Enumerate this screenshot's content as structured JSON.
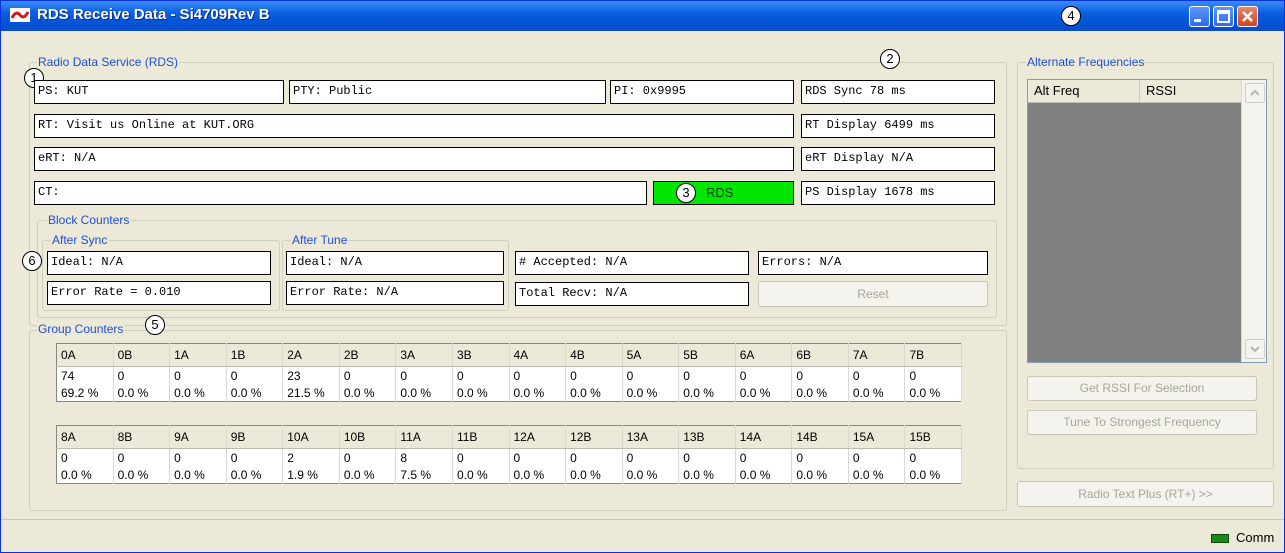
{
  "window": {
    "title": "RDS Receive Data - Si4709Rev B",
    "accent": "#0a5fe0"
  },
  "rds": {
    "group_label": "Radio Data Service (RDS)",
    "ps": "PS: KUT",
    "pty": "PTY: Public",
    "pi": "PI: 0x9995",
    "rt": "RT: Visit us Online at KUT.ORG",
    "ert": "eRT: N/A",
    "ct": "CT:",
    "indicator": "RDS",
    "indicator_color": "#00e600",
    "rds_sync": "RDS Sync 78 ms",
    "rt_display": "RT Display 6499 ms",
    "ert_display": "eRT Display N/A",
    "ps_display": "PS Display 1678 ms"
  },
  "block_counters": {
    "label": "Block Counters",
    "after_sync": {
      "label": "After Sync",
      "ideal": "Ideal: N/A",
      "error_rate": "Error Rate = 0.010"
    },
    "after_tune": {
      "label": "After Tune",
      "ideal": "Ideal: N/A",
      "error_rate": "Error Rate:  N/A"
    },
    "accepted": "# Accepted: N/A",
    "errors": "Errors: N/A",
    "total_recv": "Total Recv: N/A",
    "reset_label": "Reset"
  },
  "group_counters": {
    "label": "Group Counters",
    "table1": {
      "headers": [
        "0A",
        "0B",
        "1A",
        "1B",
        "2A",
        "2B",
        "3A",
        "3B",
        "4A",
        "4B",
        "5A",
        "5B",
        "6A",
        "6B",
        "7A",
        "7B"
      ],
      "counts": [
        "74",
        "0",
        "0",
        "0",
        "23",
        "0",
        "0",
        "0",
        "0",
        "0",
        "0",
        "0",
        "0",
        "0",
        "0",
        "0"
      ],
      "percents": [
        "69.2 %",
        "0.0 %",
        "0.0 %",
        "0.0 %",
        "21.5 %",
        "0.0 %",
        "0.0 %",
        "0.0 %",
        "0.0 %",
        "0.0 %",
        "0.0 %",
        "0.0 %",
        "0.0 %",
        "0.0 %",
        "0.0 %",
        "0.0 %"
      ]
    },
    "table2": {
      "headers": [
        "8A",
        "8B",
        "9A",
        "9B",
        "10A",
        "10B",
        "11A",
        "11B",
        "12A",
        "12B",
        "13A",
        "13B",
        "14A",
        "14B",
        "15A",
        "15B"
      ],
      "counts": [
        "0",
        "0",
        "0",
        "0",
        "2",
        "0",
        "8",
        "0",
        "0",
        "0",
        "0",
        "0",
        "0",
        "0",
        "0",
        "0"
      ],
      "percents": [
        "0.0 %",
        "0.0 %",
        "0.0 %",
        "0.0 %",
        "1.9 %",
        "0.0 %",
        "7.5 %",
        "0.0 %",
        "0.0 %",
        "0.0 %",
        "0.0 %",
        "0.0 %",
        "0.0 %",
        "0.0 %",
        "0.0 %",
        "0.0 %"
      ]
    }
  },
  "alt_freq": {
    "label": "Alternate Frequencies",
    "col_freq": "Alt Freq",
    "col_rssi": "RSSI",
    "get_rssi_label": "Get RSSI For Selection",
    "tune_strongest_label": "Tune To Strongest Frequency"
  },
  "rt_plus_label": "Radio Text Plus (RT+) >>",
  "status": {
    "comm_label": "Comm",
    "comm_color": "#1a8a1a"
  },
  "callouts": [
    "1",
    "2",
    "3",
    "4",
    "5",
    "6"
  ]
}
